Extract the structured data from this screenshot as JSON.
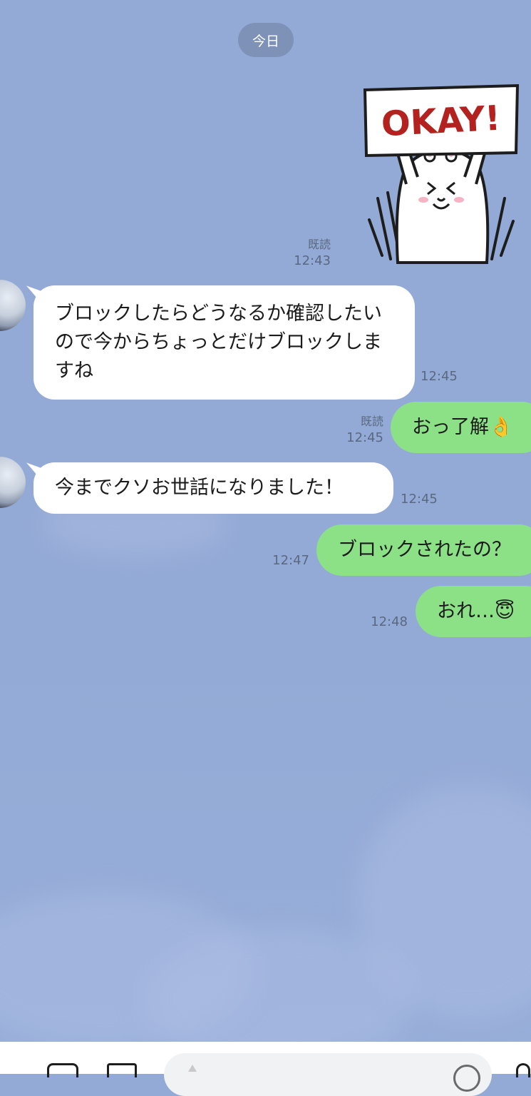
{
  "header": {
    "date_label": "今日"
  },
  "messages": [
    {
      "dir": "out",
      "kind": "sticker",
      "sticker_text": "OKAY!",
      "read": "既読",
      "time": "12:43"
    },
    {
      "dir": "in",
      "text": "ブロックしたらどうなるか確認したいので今からちょっとだけブロックしますね",
      "time": "12:45"
    },
    {
      "dir": "out",
      "text": "おっ了解👌",
      "read": "既読",
      "time": "12:45"
    },
    {
      "dir": "in",
      "text": "今までクソお世話になりました！",
      "time": "12:45"
    },
    {
      "dir": "out",
      "text": "ブロックされたの？",
      "time": "12:47"
    },
    {
      "dir": "out",
      "text": "おれ…😇",
      "time": "12:48"
    }
  ],
  "input": {
    "placeholder": ""
  },
  "colors": {
    "background": "#93aad6",
    "outgoing_bubble": "#8ce187",
    "incoming_bubble": "#ffffff",
    "date_pill": "#7e92b8"
  }
}
